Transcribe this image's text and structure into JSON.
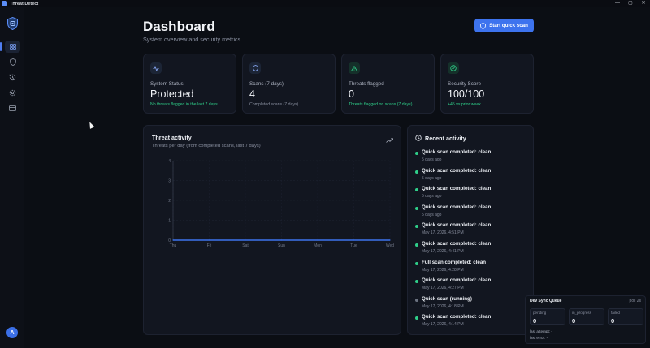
{
  "window": {
    "title": "Threat Detect",
    "controls": [
      "—",
      "▢",
      "✕"
    ]
  },
  "colors": {
    "accent": "#3d73ee",
    "success": "#2fd08a",
    "pending": "#6b7280"
  },
  "sidebar": {
    "items": [
      {
        "name": "dashboard",
        "icon": "grid-icon",
        "active": true
      },
      {
        "name": "protection",
        "icon": "shield-icon",
        "active": false
      },
      {
        "name": "history",
        "icon": "history-icon",
        "active": false
      },
      {
        "name": "settings",
        "icon": "gear-icon",
        "active": false
      },
      {
        "name": "billing",
        "icon": "card-icon",
        "active": false
      }
    ],
    "avatar_initial": "A"
  },
  "header": {
    "title": "Dashboard",
    "subtitle": "System overview and security metrics",
    "primary_button": "Start quick scan"
  },
  "stats": [
    {
      "icon": "activity-icon",
      "label": "System Status",
      "value": "Protected",
      "sub": "No threats flagged in the last 7 days"
    },
    {
      "icon": "shield-icon",
      "label": "Scans (7 days)",
      "value": "4",
      "sub": "Completed scans (7 days)"
    },
    {
      "icon": "warning-icon",
      "label": "Threats flagged",
      "value": "0",
      "sub": "Threats flagged on scans (7 days)"
    },
    {
      "icon": "check-circle-icon",
      "label": "Security Score",
      "value": "100/100",
      "sub": "+45 vs prior week"
    }
  ],
  "threat_panel": {
    "title": "Threat activity",
    "subtitle": "Threats per day (from completed scans, last 7 days)"
  },
  "chart_data": {
    "type": "line",
    "categories": [
      "Thu",
      "Fri",
      "Sat",
      "Sun",
      "Mon",
      "Tue",
      "Wed"
    ],
    "series": [
      {
        "values": [
          0,
          0,
          0,
          0,
          0,
          0,
          0
        ]
      }
    ],
    "y_ticks": [
      "0",
      "1",
      "2",
      "3",
      "4"
    ],
    "ylim": [
      0,
      4
    ],
    "grid": true
  },
  "recent": {
    "title": "Recent activity",
    "items": [
      {
        "title": "Quick scan completed: clean",
        "date": "5 days ago",
        "status": "success"
      },
      {
        "title": "Quick scan completed: clean",
        "date": "5 days ago",
        "status": "success"
      },
      {
        "title": "Quick scan completed: clean",
        "date": "5 days ago",
        "status": "success"
      },
      {
        "title": "Quick scan completed: clean",
        "date": "5 days ago",
        "status": "success"
      },
      {
        "title": "Quick scan completed: clean",
        "date": "May 17, 2026, 4:51 PM",
        "status": "success"
      },
      {
        "title": "Quick scan completed: clean",
        "date": "May 17, 2026, 4:41 PM",
        "status": "success"
      },
      {
        "title": "Full scan completed: clean",
        "date": "May 17, 2026, 4:28 PM",
        "status": "success"
      },
      {
        "title": "Quick scan completed: clean",
        "date": "May 17, 2026, 4:27 PM",
        "status": "success"
      },
      {
        "title": "Quick scan (running)",
        "date": "May 17, 2026, 4:18 PM",
        "status": "pending"
      },
      {
        "title": "Quick scan completed: clean",
        "date": "May 17, 2026, 4:14 PM",
        "status": "success"
      }
    ]
  },
  "queue": {
    "title": "Dev Sync Queue",
    "poll": "poll 2s",
    "pending_label": "pending",
    "pending_value": "0",
    "in_progress_label": "in_progress",
    "in_progress_value": "0",
    "failed_label": "failed",
    "failed_value": "0",
    "last_attempt": "last attempt: -",
    "last_error": "last error: -"
  }
}
